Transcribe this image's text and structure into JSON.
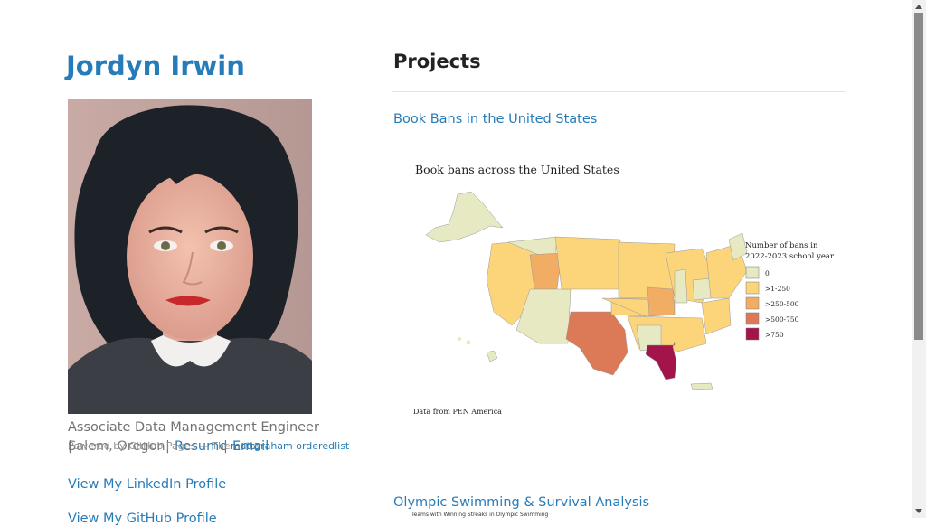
{
  "profile": {
    "name": "Jordyn Irwin",
    "tagline_role": "Associate Data Management Engineer",
    "tagline_location": "Salem, Oregon",
    "resume_label": "Resume",
    "email_label": "Email",
    "credit_text": "Powered by GitHub Pages — Theme by ",
    "credit_link": "mattgraham orderedlist",
    "linkedin_label": "View My LinkedIn Profile",
    "extra_link": "View My GitHub Profile"
  },
  "projects": {
    "heading": "Projects",
    "items": [
      {
        "label": "Book Bans in the United States"
      },
      {
        "label": "Olympic Swimming & Survival Analysis"
      }
    ],
    "thumbnail_caption": "Teams with Winning Streaks in Olympic Swimming"
  },
  "map": {
    "title": "Book bans across the United States",
    "legend_title_line1": "Number of bans in",
    "legend_title_line2": "2022-2023 school year",
    "legend": [
      {
        "label": "0",
        "color": "#e6e9c2"
      },
      {
        "label": ">1-250",
        "color": "#fcd57b"
      },
      {
        "label": ">250-500",
        "color": "#f2ad64"
      },
      {
        "label": ">500-750",
        "color": "#dc7a58"
      },
      {
        "label": ">750",
        "color": "#a3154a"
      }
    ],
    "source": "Data from PEN America"
  },
  "colors": {
    "accent": "#267CB9",
    "scrollbar_thumb": "#8a8a8a"
  }
}
